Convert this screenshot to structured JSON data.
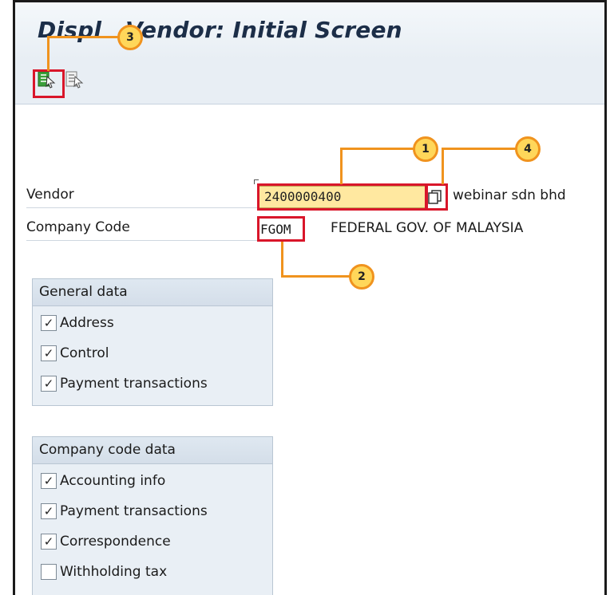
{
  "window": {
    "title": "Display Vendor: Initial Screen",
    "title_visible_start": "Displ",
    "title_visible_end": "Vendor: Initial Screen"
  },
  "toolbar": {
    "buttons": [
      {
        "icon": "execute-icon",
        "highlighted": true
      },
      {
        "icon": "other-screen-icon",
        "highlighted": false
      }
    ]
  },
  "fields": {
    "vendor_label": "Vendor",
    "vendor_value": "2400000400",
    "vendor_description": "webinar sdn bhd",
    "company_code_label": "Company Code",
    "company_code_value": "FGOM",
    "company_code_description": "FEDERAL GOV. OF MALAYSIA"
  },
  "general_data": {
    "title": "General data",
    "items": [
      {
        "label": "Address",
        "checked": true
      },
      {
        "label": "Control",
        "checked": true
      },
      {
        "label": "Payment transactions",
        "checked": true
      }
    ]
  },
  "company_code_data": {
    "title": "Company code data",
    "items": [
      {
        "label": "Accounting info",
        "checked": true
      },
      {
        "label": "Payment transactions",
        "checked": true
      },
      {
        "label": "Correspondence",
        "checked": true
      },
      {
        "label": "Withholding tax",
        "checked": false
      }
    ]
  },
  "callouts": [
    "1",
    "2",
    "3",
    "4"
  ],
  "colors": {
    "highlight": "#d9162a",
    "callout_fill": "#ffd75a",
    "callout_border": "#f0931e",
    "title": "#1c2e48",
    "input_bg": "#ffe8a0"
  }
}
